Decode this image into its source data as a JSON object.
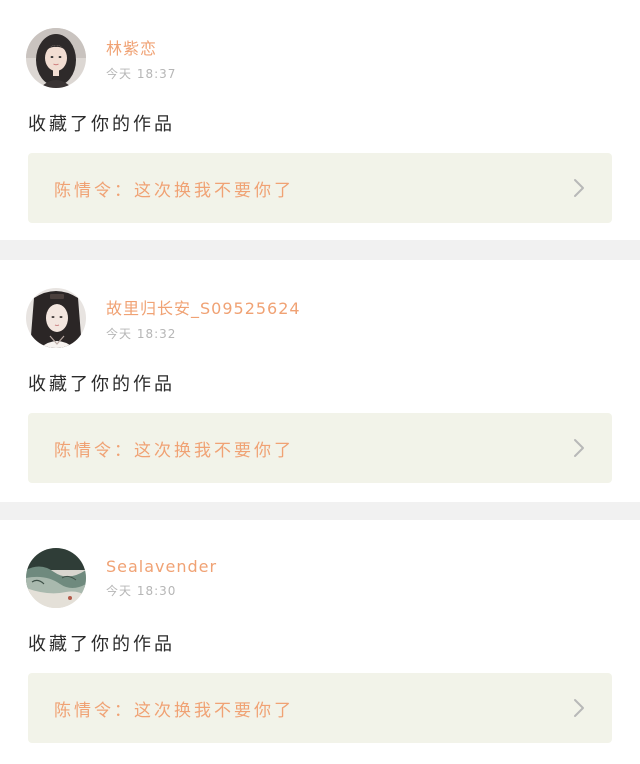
{
  "colors": {
    "accent": "#f0a274",
    "card_link_background": "#f2f3e9",
    "separator": "#f1f1f1",
    "time_text": "#b6b6b6"
  },
  "notifications": [
    {
      "user_name": "林紫恋",
      "time": "今天 18:37",
      "action": "收藏了你的作品",
      "work_title": "陈情令：这次换我不要你了",
      "link_icon": "chevron-right-icon",
      "avatar": "avatar-photo-girl"
    },
    {
      "user_name": "故里归长安_S09525624",
      "time": "今天 18:32",
      "action": "收藏了你的作品",
      "work_title": "陈情令：这次换我不要你了",
      "link_icon": "chevron-right-icon",
      "avatar": "avatar-illustration-ancient"
    },
    {
      "user_name": "Sealavender",
      "time": "今天 18:30",
      "action": "收藏了你的作品",
      "work_title": "陈情令：这次换我不要你了",
      "link_icon": "chevron-right-icon",
      "avatar": "avatar-ink-landscape"
    }
  ]
}
